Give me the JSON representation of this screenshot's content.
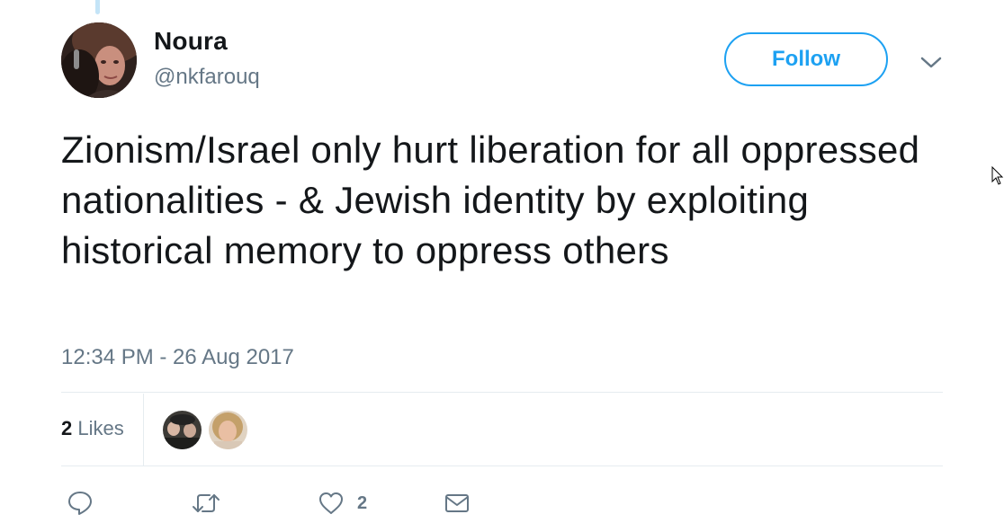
{
  "author": {
    "name": "Noura",
    "handle": "@nkfarouq"
  },
  "follow_button": {
    "label": "Follow"
  },
  "tweet": {
    "text": "Zionism/Israel only hurt liberation for all oppressed nationalities - & Jewish identity by exploiting historical memory to oppress others",
    "timestamp": "12:34 PM - 26 Aug 2017"
  },
  "stats": {
    "likes_count": "2",
    "likes_label": "Likes"
  },
  "actions": {
    "reply_icon": "reply-icon",
    "retweet_icon": "retweet-icon",
    "like_icon": "heart-icon",
    "like_count": "2",
    "dm_icon": "envelope-icon"
  },
  "colors": {
    "accent": "#1da1f2",
    "secondary_text": "#657786",
    "primary_text": "#14171a",
    "divider": "#e6ecf0"
  }
}
